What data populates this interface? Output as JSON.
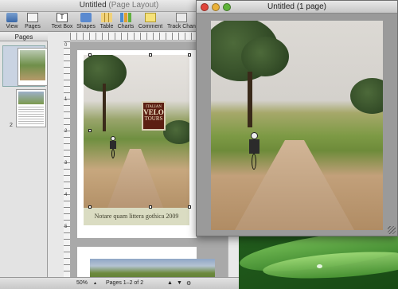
{
  "desktop": {
    "name": "Desktop"
  },
  "pages_window": {
    "title": "Untitled",
    "title_suffix": "(Page Layout)",
    "toolbar": [
      {
        "label": "View"
      },
      {
        "label": "Pages"
      },
      {
        "label": "Text Box"
      },
      {
        "label": "Shapes"
      },
      {
        "label": "Table"
      },
      {
        "label": "Charts"
      },
      {
        "label": "Comment"
      },
      {
        "label": "Track Chan"
      }
    ],
    "sidebar": {
      "label": "Pages",
      "page_numbers": [
        "1",
        "2"
      ]
    },
    "ruler_marks": [
      "0",
      "1",
      "2",
      "3",
      "4",
      "5",
      "6",
      "7",
      "8",
      "9"
    ],
    "logo": {
      "line1": "ITALIAN",
      "line2": "VELO",
      "line3": "TOURS"
    },
    "caption": "Notare quam littera gothica 2009",
    "status": {
      "zoom": "50%",
      "pages": "Pages 1–2 of 2"
    }
  },
  "preview_window": {
    "title": "Untitled (1 page)"
  },
  "colors": {
    "logo_bg": "#5c1f12",
    "caption_bg": "#dadcc2",
    "close": "#e0443a",
    "minimize": "#e9b13a",
    "zoom": "#5fb33a"
  }
}
